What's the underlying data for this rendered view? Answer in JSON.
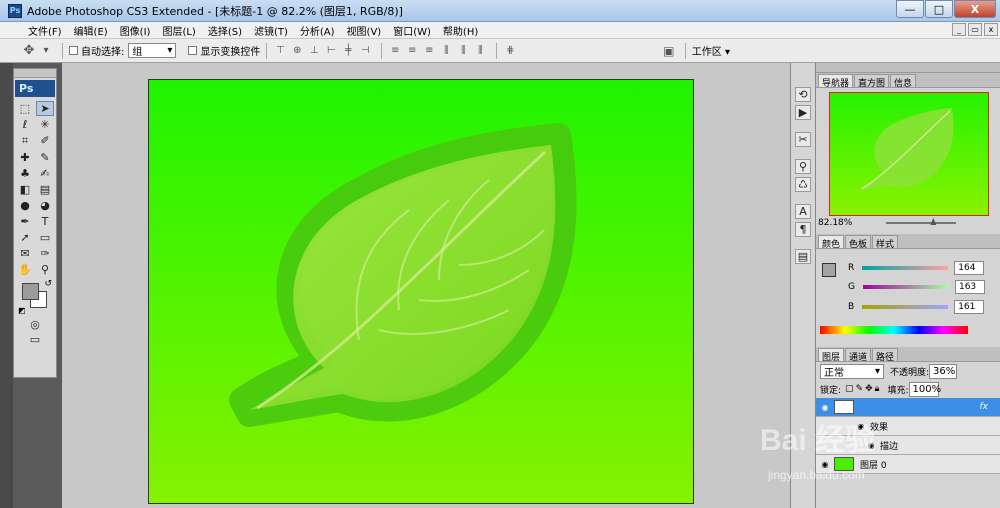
{
  "window": {
    "title": "Adobe Photoshop CS3 Extended - [未标题-1 @ 82.2% (图层1, RGB/8)]",
    "icon": "ps-app-icon",
    "buttons": [
      "—",
      "□",
      "X"
    ]
  },
  "menu": {
    "items": [
      "文件(F)",
      "编辑(E)",
      "图像(I)",
      "图层(L)",
      "选择(S)",
      "滤镜(T)",
      "分析(A)",
      "视图(V)",
      "窗口(W)",
      "帮助(H)"
    ]
  },
  "options": {
    "auto_select_label": "自动选择:",
    "auto_select_value": "组",
    "show_transform_label": "显示变换控件",
    "workspace_label": "工作区 ▾"
  },
  "toolbox": {
    "logo": "Ps"
  },
  "panels": {
    "navigator": {
      "tabs": [
        "导航器",
        "直方图",
        "信息"
      ],
      "zoom": "82.18%"
    },
    "color": {
      "tabs": [
        "颜色",
        "色板",
        "样式"
      ],
      "channels": [
        {
          "label": "R",
          "value": "164"
        },
        {
          "label": "G",
          "value": "163"
        },
        {
          "label": "B",
          "value": "161"
        }
      ]
    },
    "layers": {
      "tabs": [
        "图层",
        "通道",
        "路径"
      ],
      "blend_mode": "正常",
      "opacity_label": "不透明度:",
      "opacity_value": "36%",
      "lock_label": "锁定:",
      "fill_label": "填充:",
      "fill_value": "100%",
      "rows": [
        {
          "name": "",
          "fx": "fx"
        },
        {
          "name": "效果"
        },
        {
          "name": "描边"
        },
        {
          "name": "图层 0"
        }
      ]
    }
  },
  "watermark": {
    "main": "Bai 经验",
    "url": "jingyan.baidu.com"
  },
  "colors": {
    "canvas_top": "#1ff400",
    "canvas_bottom": "#86f200",
    "active_layer": "#3d8ee6",
    "ps_blue": "#1d4f91"
  }
}
